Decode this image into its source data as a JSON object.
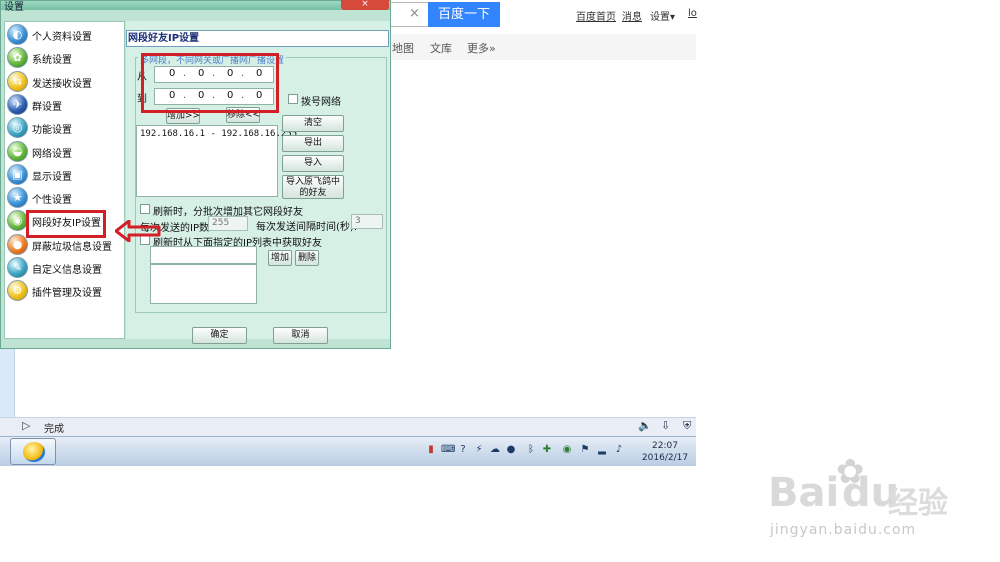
{
  "browser": {
    "search_button": "百度一下",
    "search_clear": "×",
    "top_links": [
      "百度首页",
      "消息",
      "设置▾",
      "lo"
    ],
    "nav_links": [
      "地图",
      "文库",
      "更多»"
    ],
    "status": "完成"
  },
  "dialog": {
    "title": "设置",
    "close": "×",
    "menu": [
      {
        "label": "个人资料设置",
        "icon": "user-globe-icon"
      },
      {
        "label": "系统设置",
        "icon": "gear-icon"
      },
      {
        "label": "发送接收设置",
        "icon": "transfer-icon"
      },
      {
        "label": "群设置",
        "icon": "group-icon"
      },
      {
        "label": "功能设置",
        "icon": "function-icon"
      },
      {
        "label": "网络设置",
        "icon": "network-icon"
      },
      {
        "label": "显示设置",
        "icon": "display-icon"
      },
      {
        "label": "个性设置",
        "icon": "star-icon"
      },
      {
        "label": "网段好友IP设置",
        "icon": "ip-segment-icon"
      },
      {
        "label": "屏蔽垃圾信息设置",
        "icon": "block-icon"
      },
      {
        "label": "自定义信息设置",
        "icon": "custom-info-icon"
      },
      {
        "label": "插件管理及设置",
        "icon": "plugin-icon"
      }
    ],
    "selected_index": 8,
    "panel_title": "网段好友IP设置",
    "group_legend": "多网段，不同网关或广播网广播设置",
    "from_label": "从",
    "to_label": "到",
    "from_ip": [
      "0",
      "0",
      "0",
      "0"
    ],
    "to_ip": [
      "0",
      "0",
      "0",
      "0"
    ],
    "dial_network": "拨号网络",
    "add_button": "增加>>",
    "remove_button": "移除<<",
    "ip_list": [
      "192.168.16.1 - 192.168.16.255"
    ],
    "clear_button": "清空",
    "export_button": "导出",
    "import_button": "导入",
    "import_friends_button_1": "导入原飞鸽中",
    "import_friends_button_2": "的好友",
    "batch_label": "刷新时，分批次增加其它网段好友",
    "per_send_label": "每次发送的IP数:",
    "per_send_value": "255",
    "interval_label": "每次发送间隔时间(秒):",
    "interval_value": "3",
    "get_from_list_label": "刷新时从下面指定的IP列表中获取好友",
    "add_small": "增加",
    "delete_small": "删除",
    "ok_button": "确定",
    "cancel_button": "取消"
  },
  "taskbar": {
    "time": "22:07",
    "date": "2016/2/17"
  },
  "watermark": {
    "brand": "Bai",
    "brand2": "du",
    "site": "经验",
    "url": "jingyan.baidu.com"
  },
  "colors": {
    "accent_red": "#d31f27",
    "baidu_blue": "#3385ff",
    "dialog_bg": "#bfe4d4"
  }
}
